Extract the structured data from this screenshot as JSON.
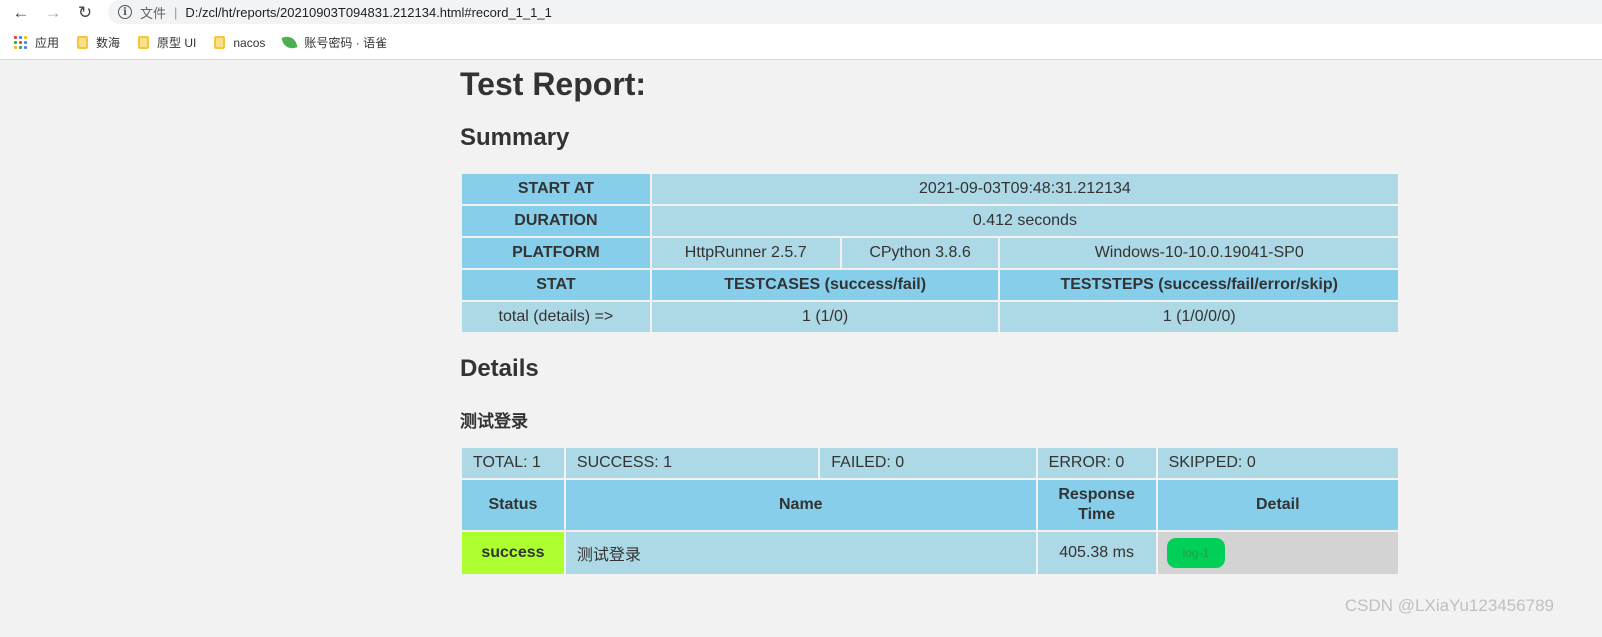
{
  "browser": {
    "file_label": "文件",
    "separator": "|",
    "url": "D:/zcl/ht/reports/20210903T094831.212134.html#record_1_1_1",
    "bookmarks": [
      {
        "label": "应用",
        "icon": "apps-grid-icon"
      },
      {
        "label": "数海",
        "icon": "folder-icon"
      },
      {
        "label": "原型 UI",
        "icon": "folder-icon"
      },
      {
        "label": "nacos",
        "icon": "folder-icon"
      },
      {
        "label": "账号密码 · 语雀",
        "icon": "leaf-icon"
      }
    ],
    "colors": {
      "folder": "#f5c542",
      "leaf": "#4caf50"
    }
  },
  "report": {
    "title": "Test Report:",
    "summary_heading": "Summary",
    "summary": {
      "start_at_label": "START AT",
      "start_at_value": "2021-09-03T09:48:31.212134",
      "duration_label": "DURATION",
      "duration_value": "0.412 seconds",
      "platform_label": "PLATFORM",
      "platform_runner": "HttpRunner 2.5.7",
      "platform_python": "CPython 3.8.6",
      "platform_os": "Windows-10-10.0.19041-SP0",
      "stat_label": "STAT",
      "testcases_label": "TESTCASES (success/fail)",
      "teststeps_label": "TESTSTEPS (success/fail/error/skip)",
      "total_label": "total (details) =>",
      "testcases_value": "1 (1/0)",
      "teststeps_value": "1 (1/0/0/0)"
    },
    "details_heading": "Details",
    "testcase_name": "测试登录",
    "counts": {
      "total": "TOTAL: 1",
      "success": "SUCCESS: 1",
      "failed": "FAILED: 0",
      "error": "ERROR: 0",
      "skipped": "SKIPPED: 0"
    },
    "columns": {
      "status": "Status",
      "name": "Name",
      "response_time_1": "Response",
      "response_time_2": "Time",
      "detail": "Detail"
    },
    "rows": [
      {
        "status": "success",
        "name": "测试登录",
        "response_time": "405.38 ms",
        "log_label": "log-1"
      }
    ],
    "colors": {
      "header": "#87ceeb",
      "cell": "#add8e6",
      "success": "#adff2f",
      "detail_bg": "#d3d3d3",
      "log_button": "#00d057"
    }
  },
  "watermark": "CSDN @LXiaYu123456789"
}
